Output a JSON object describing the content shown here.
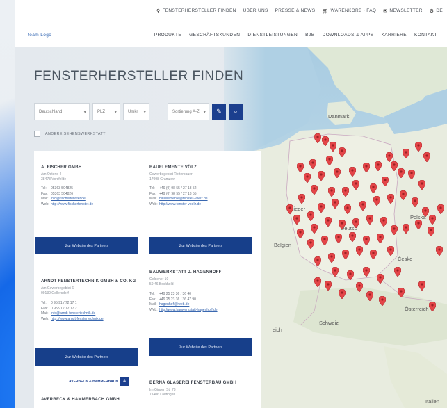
{
  "utility_bar": {
    "items": [
      {
        "icon": "location-pin-icon",
        "label": "FENSTERHERSTELLER FINDEN"
      },
      {
        "icon": "",
        "label": "ÜBER UNS"
      },
      {
        "icon": "",
        "label": "PRESSE & NEWS"
      },
      {
        "icon": "cart-icon",
        "label": "WARENKORB · FAQ"
      },
      {
        "icon": "mail-icon",
        "label": "NEWSLETTER"
      },
      {
        "icon": "gear-icon",
        "label": "DE"
      }
    ]
  },
  "nav": {
    "logo": "team Logo",
    "links": [
      "PRODUKTE",
      "GESCHÄFTSKUNDEN",
      "DIENSTLEISTUNGEN",
      "B2B",
      "DOWNLOADS & APPS",
      "KARRIERE",
      "KONTAKT"
    ]
  },
  "main": {
    "title": "FENSTERHERSTELLER FINDEN",
    "filters": {
      "country": "Deutschland",
      "zip": "PLZ",
      "radius": "Umkr",
      "sort": "Sortierung A-Z"
    },
    "checkbox_label": "ANDERE SEHENSWERKSTATT"
  },
  "partners": [
    {
      "name": "A. FISCHER GMBH",
      "address": [
        "Am Ostend 4",
        "38473 Vorsfelde"
      ],
      "tel": "05363 504825",
      "fax": "05363 504826",
      "mail": "info@fischerfenster.de",
      "web": "http://www.fischerfenster.de",
      "button": "Zur Website des Partners"
    },
    {
      "name": "BAUELEMENTE VÖLZ",
      "address": [
        "Gewerbegebiet Rotterbauer",
        "17098 Gramzow"
      ],
      "tel": "+49 (0) 98 55 / 27 13 52",
      "fax": "+49 (0) 98 55 / 27 13 55",
      "mail": "bauelemente@fenster-voelz.de",
      "web": "http://www.fenster-voelz.de",
      "button": "Zur Website des Partners"
    },
    {
      "name": "ARNDT FENSTERTECHNIK GMBH & CO. KG",
      "address": [
        "Am Gewerbegebiet 6",
        "09130 Gellersdorf"
      ],
      "tel": "0 95 91 / 72 17 1",
      "fax": "0 95 91 / 72 17 2",
      "mail": "info@arndt-fenstertechnik.de",
      "web": "http://www.arndt-fenstertechnik.de",
      "button": "Zur Website des Partners"
    },
    {
      "name": "BAUWERKSTATT J. HAGENHOFF",
      "address": [
        "Gelsener 10",
        "59 46 Bockhold"
      ],
      "tel": "+49 25 23 36 / 36 40",
      "fax": "+49 25 23 36 / 36 47 90",
      "mail": "hagenhoff@web.de",
      "web": "http://www.bauwerkstatt-hagenhoff.de",
      "button": "Zur Website des Partners"
    },
    {
      "name": "AVERBECK & HAMMERBACH GMBH",
      "logo_text": "AVERBECK & HAMMERBACH"
    },
    {
      "name": "BERNA GLASEREI FENSTERBAU GMBH",
      "address": [
        "Im Ginsen Str 73",
        "71406 Laufingen"
      ]
    }
  ],
  "map": {
    "labels": [
      "Danmark",
      "Nieder",
      "Belgien",
      "Deutsc",
      "Polska",
      "Česko",
      "Schweiz",
      "Österreich",
      "Italien",
      "eich"
    ]
  },
  "colors": {
    "accent": "#173f8a",
    "pin": "#e44548",
    "map_water": "#aacde2"
  }
}
